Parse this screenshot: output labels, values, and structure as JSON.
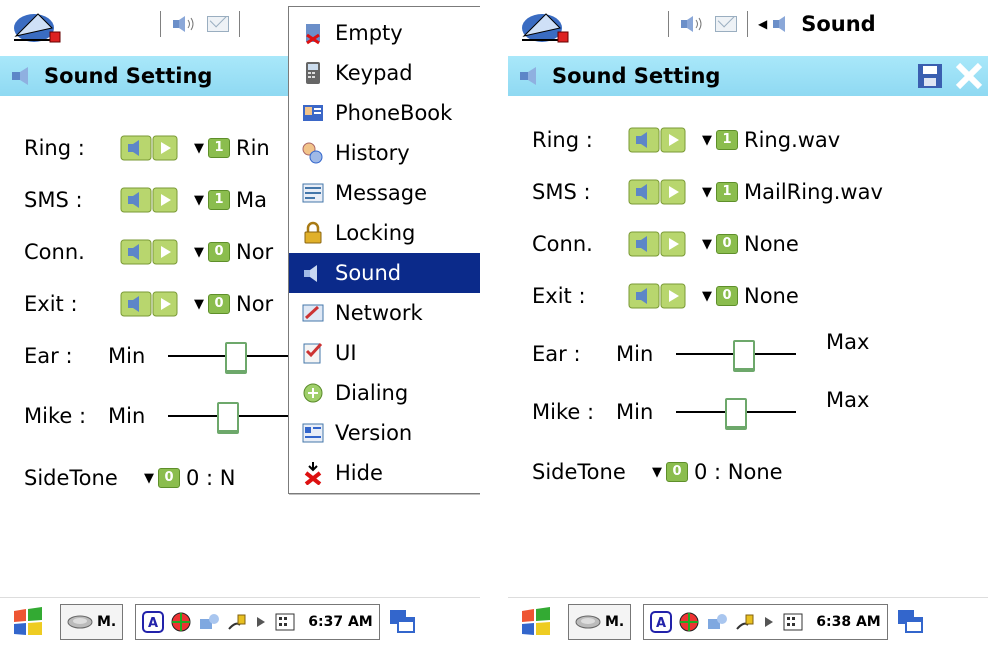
{
  "left": {
    "window_title": "Sound Setting",
    "rows": [
      {
        "label": "Ring :",
        "index": "1",
        "value": "Rin"
      },
      {
        "label": "SMS :",
        "index": "1",
        "value": "Ma"
      },
      {
        "label": "Conn.",
        "index": "0",
        "value": "Nor"
      },
      {
        "label": "Exit :",
        "index": "0",
        "value": "Nor"
      }
    ],
    "ear": {
      "label": "Ear :",
      "min": "Min",
      "level": 0.58
    },
    "mike": {
      "label": "Mike :",
      "min": "Min",
      "level": 0.5
    },
    "sidetone": {
      "label": "SideTone",
      "index": "0",
      "value": "0 : N"
    },
    "menu": {
      "items": [
        "Empty",
        "Keypad",
        "PhoneBook",
        "History",
        "Message",
        "Locking",
        "Sound",
        "Network",
        "UI",
        "Dialing",
        "Version",
        "Hide"
      ],
      "selected": "Sound"
    },
    "taskbar": {
      "app_label": "M.",
      "time": "6:37 AM"
    }
  },
  "right": {
    "active_app": "Sound",
    "window_title": "Sound Setting",
    "rows": [
      {
        "label": "Ring :",
        "index": "1",
        "value": "Ring.wav"
      },
      {
        "label": "SMS :",
        "index": "1",
        "value": "MailRing.wav"
      },
      {
        "label": "Conn.",
        "index": "0",
        "value": "None"
      },
      {
        "label": "Exit :",
        "index": "0",
        "value": "None"
      }
    ],
    "ear": {
      "label": "Ear :",
      "min": "Min",
      "max": "Max",
      "level": 0.58
    },
    "mike": {
      "label": "Mike :",
      "min": "Min",
      "max": "Max",
      "level": 0.5
    },
    "sidetone": {
      "label": "SideTone",
      "index": "0",
      "value": "0 : None"
    },
    "taskbar": {
      "app_label": "M.",
      "time": "6:38 AM"
    }
  },
  "colors": {
    "title_bar": "#9fe1f7",
    "menu_highlight": "#0b2a8a",
    "index_badge": "#8bbd4e",
    "slider_thumb": "#6da86b"
  }
}
